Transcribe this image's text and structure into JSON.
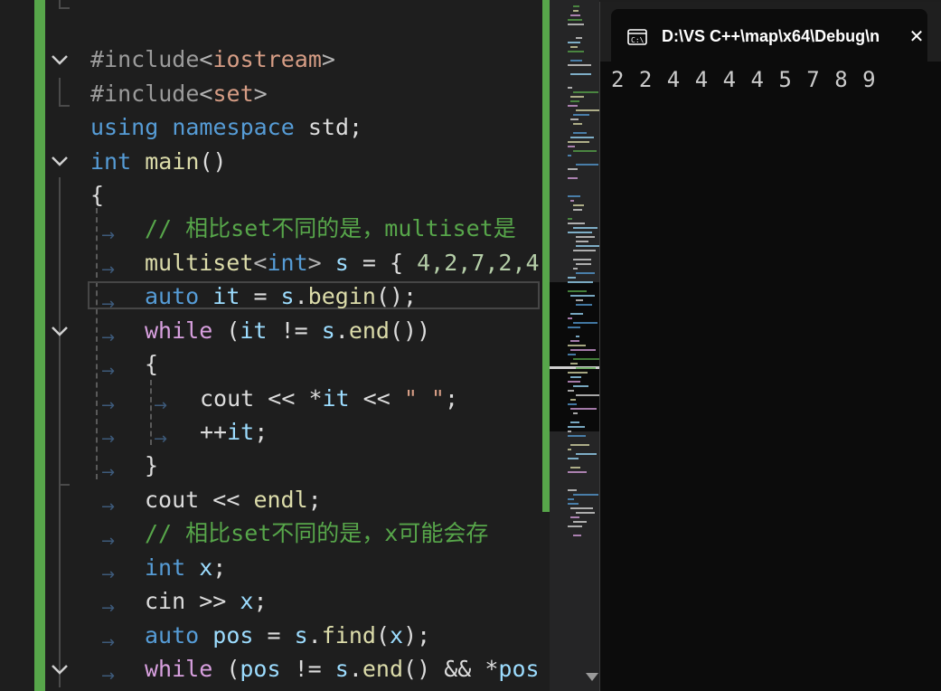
{
  "editor": {
    "lines": {
      "l0": {
        "pp": "#include",
        "lt": "<",
        "hdr": "iostream",
        "gt": ">"
      },
      "l1": {
        "pp": "#include",
        "lt": "<",
        "hdr": "set",
        "gt": ">"
      },
      "l2": {
        "kw1": "using",
        "kw2": "namespace",
        "id": "std",
        "semi": ";"
      },
      "l3": {
        "kw": "int",
        "fn": "main",
        "paren": "()"
      },
      "l4": {
        "brace": "{"
      },
      "l5": {
        "comment": "// 相比set不同的是，multiset是"
      },
      "l6": {
        "type": "multiset",
        "lt": "<",
        "kw": "int",
        "gt": ">",
        "var": "s",
        "rest1": " = { ",
        "nums": "4,2,7,2,4"
      },
      "l7": {
        "kw": "auto",
        "var": "it",
        "op": " = ",
        "var2": "s",
        "dot": ".",
        "fn": "begin",
        "end": "();"
      },
      "l8": {
        "ctl": "while",
        "p1": " (",
        "var": "it",
        "op": " != ",
        "var2": "s",
        "dot": ".",
        "fn": "end",
        "end": "())"
      },
      "l9": {
        "brace": "{"
      },
      "l10": {
        "id": "cout",
        "op": " << ",
        "star": "*",
        "var": "it",
        "op2": " << ",
        "str": "\" \"",
        "semi": ";"
      },
      "l11": {
        "op": "++",
        "var": "it",
        "semi": ";"
      },
      "l12": {
        "brace": "}"
      },
      "l13": {
        "id": "cout",
        "op": " << ",
        "fn": "endl",
        "semi": ";"
      },
      "l14": {
        "comment": "// 相比set不同的是，x可能会存"
      },
      "l15": {
        "kw": "int",
        "var": "x",
        "semi": ";"
      },
      "l16": {
        "id": "cin",
        "op": " >> ",
        "var": "x",
        "semi": ";"
      },
      "l17": {
        "kw": "auto",
        "var": "pos",
        "op": " = ",
        "var2": "s",
        "dot": ".",
        "fn": "find",
        "p1": "(",
        "var3": "x",
        "end": ");"
      },
      "l18": {
        "ctl": "while",
        "p1": " (",
        "var": "pos",
        "op": " != ",
        "var2": "s",
        "dot": ".",
        "fn": "end",
        "p2": "()",
        "op2": " && ",
        "star": "*",
        "var3": "pos"
      }
    }
  },
  "console": {
    "title": "D:\\VS C++\\map\\x64\\Debug\\n",
    "icon": "terminal-icon",
    "close_icon": "close-icon",
    "output": "2 2 4 4 4 4 5 7 8 9"
  },
  "colors": {
    "keyword": "#569cd6",
    "control": "#d8a0df",
    "function": "#dcdcaa",
    "variable": "#9cdcfe",
    "string": "#d69d85",
    "number": "#b5cea8",
    "comment": "#57a64a",
    "type": "#4ec9b0",
    "change_bar": "#57a64a"
  }
}
